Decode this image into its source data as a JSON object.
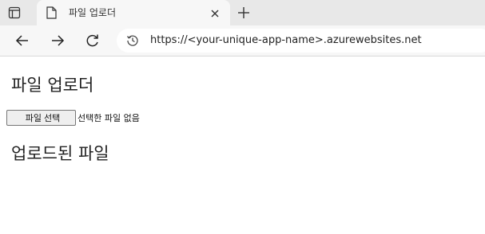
{
  "browser": {
    "tab": {
      "title": "파일 업로더"
    },
    "address": {
      "url": "https://<your-unique-app-name>.azurewebsites.net"
    }
  },
  "page": {
    "heading": "파일 업로더",
    "file_input": {
      "button_label": "파일 선택",
      "status_text": "선택한 파일 없음"
    },
    "uploaded_heading": "업로드된 파일"
  },
  "icons": {
    "tab_actions": "tab-actions-icon",
    "tab_page": "page-icon",
    "tab_close": "close-icon",
    "new_tab": "plus-icon",
    "back": "arrow-left-icon",
    "forward": "arrow-right-icon",
    "refresh": "refresh-icon",
    "site_info": "history-icon"
  }
}
